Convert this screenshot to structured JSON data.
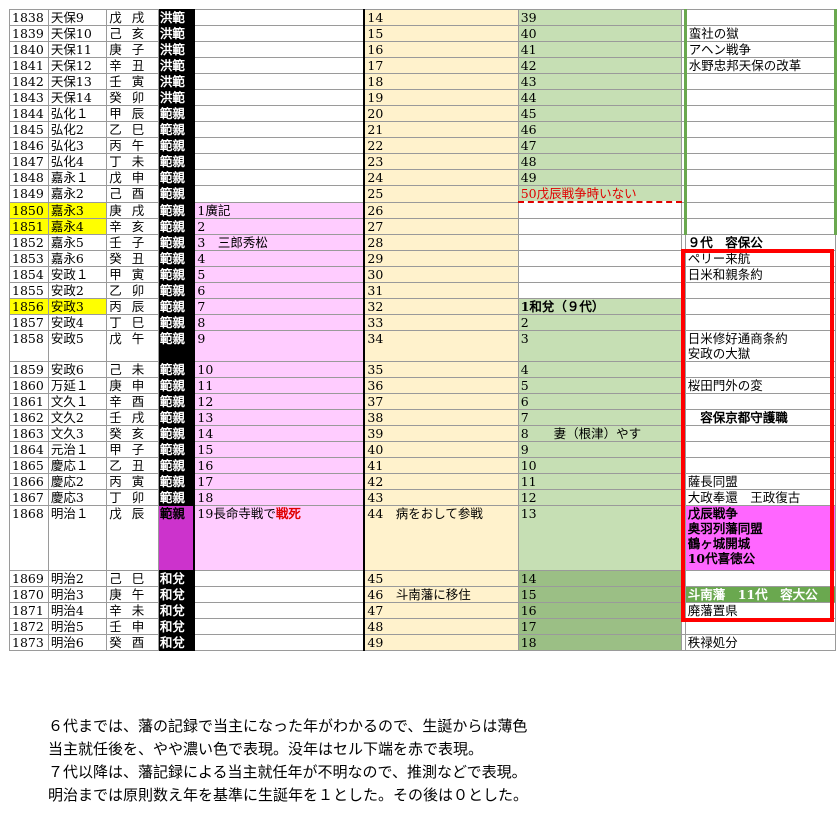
{
  "rows": [
    {
      "year": "1838",
      "era": "天保9",
      "eto": "戊 戌",
      "lord": "洪範",
      "c1": "",
      "c2": "14",
      "c3": "39",
      "c4": ""
    },
    {
      "year": "1839",
      "era": "天保10",
      "eto": "己 亥",
      "lord": "洪範",
      "c1": "",
      "c2": "15",
      "c3": "40",
      "c4": "蛮社の獄"
    },
    {
      "year": "1840",
      "era": "天保11",
      "eto": "庚 子",
      "lord": "洪範",
      "c1": "",
      "c2": "16",
      "c3": "41",
      "c4": "アヘン戦争"
    },
    {
      "year": "1841",
      "era": "天保12",
      "eto": "辛 丑",
      "lord": "洪範",
      "c1": "",
      "c2": "17",
      "c3": "42",
      "c4": "水野忠邦天保の改革"
    },
    {
      "year": "1842",
      "era": "天保13",
      "eto": "壬 寅",
      "lord": "洪範",
      "c1": "",
      "c2": "18",
      "c3": "43",
      "c4": ""
    },
    {
      "year": "1843",
      "era": "天保14",
      "eto": "癸 卯",
      "lord": "洪範",
      "c1": "",
      "c2": "19",
      "c3": "44",
      "c4": ""
    },
    {
      "year": "1844",
      "era": "弘化１",
      "eto": "甲 辰",
      "lord": "範親",
      "c1": "",
      "c2": "20",
      "c3": "45",
      "c4": ""
    },
    {
      "year": "1845",
      "era": "弘化2",
      "eto": "乙 巳",
      "lord": "範親",
      "c1": "",
      "c2": "21",
      "c3": "46",
      "c4": ""
    },
    {
      "year": "1846",
      "era": "弘化3",
      "eto": "丙 午",
      "lord": "範親",
      "c1": "",
      "c2": "22",
      "c3": "47",
      "c4": ""
    },
    {
      "year": "1847",
      "era": "弘化4",
      "eto": "丁 未",
      "lord": "範親",
      "c1": "",
      "c2": "23",
      "c3": "48",
      "c4": ""
    },
    {
      "year": "1848",
      "era": "嘉永１",
      "eto": "戊 申",
      "lord": "範親",
      "c1": "",
      "c2": "24",
      "c3": "49",
      "c4": ""
    },
    {
      "year": "1849",
      "era": "嘉永2",
      "eto": "己 酉",
      "lord": "範親",
      "c1": "",
      "c2": "25",
      "c3": "50戊辰戦争時いない",
      "c4": ""
    },
    {
      "year": "1850",
      "era": "嘉永3",
      "eto": "庚 戌",
      "lord": "範親",
      "c1": "1廣記",
      "c2": "26",
      "c3": "",
      "c4": ""
    },
    {
      "year": "1851",
      "era": "嘉永4",
      "eto": "辛 亥",
      "lord": "範親",
      "c1": "2",
      "c2": "27",
      "c3": "",
      "c4": ""
    },
    {
      "year": "1852",
      "era": "嘉永5",
      "eto": "壬 子",
      "lord": "範親",
      "c1": "3　三郎秀松",
      "c2": "28",
      "c3": "",
      "c4": "９代　容保公"
    },
    {
      "year": "1853",
      "era": "嘉永6",
      "eto": "癸 丑",
      "lord": "範親",
      "c1": "4",
      "c2": "29",
      "c3": "",
      "c4": "ペリー来航"
    },
    {
      "year": "1854",
      "era": "安政１",
      "eto": "甲 寅",
      "lord": "範親",
      "c1": "5",
      "c2": "30",
      "c3": "",
      "c4": "日米和親条約"
    },
    {
      "year": "1855",
      "era": "安政2",
      "eto": "乙 卯",
      "lord": "範親",
      "c1": "6",
      "c2": "31",
      "c3": "",
      "c4": ""
    },
    {
      "year": "1856",
      "era": "安政3",
      "eto": "丙 辰",
      "lord": "範親",
      "c1": "7",
      "c2": "32",
      "c3": "1和兌（９代）",
      "c4": ""
    },
    {
      "year": "1857",
      "era": "安政4",
      "eto": "丁 巳",
      "lord": "範親",
      "c1": "8",
      "c2": "33",
      "c3": "2",
      "c4": ""
    },
    {
      "year": "1858",
      "era": "安政5",
      "eto": "戊 午",
      "lord": "範親",
      "c1": "9",
      "c2": "34",
      "c3": "3",
      "c4": "日米修好通商条約\n安政の大獄"
    },
    {
      "year": "1859",
      "era": "安政6",
      "eto": "己 未",
      "lord": "範親",
      "c1": "10",
      "c2": "35",
      "c3": "4",
      "c4": ""
    },
    {
      "year": "1860",
      "era": "万延１",
      "eto": "庚 申",
      "lord": "範親",
      "c1": "11",
      "c2": "36",
      "c3": "5",
      "c4": "桜田門外の変"
    },
    {
      "year": "1861",
      "era": "文久１",
      "eto": "辛 酉",
      "lord": "範親",
      "c1": "12",
      "c2": "37",
      "c3": "6",
      "c4": ""
    },
    {
      "year": "1862",
      "era": "文久2",
      "eto": "壬 戌",
      "lord": "範親",
      "c1": "13",
      "c2": "38",
      "c3": "7",
      "c4": "　容保京都守護職"
    },
    {
      "year": "1863",
      "era": "文久3",
      "eto": "癸 亥",
      "lord": "範親",
      "c1": "14",
      "c2": "39",
      "c3": "8　　妻（根津）やす",
      "c4": ""
    },
    {
      "year": "1864",
      "era": "元治１",
      "eto": "甲 子",
      "lord": "範親",
      "c1": "15",
      "c2": "40",
      "c3": "9",
      "c4": ""
    },
    {
      "year": "1865",
      "era": "慶応１",
      "eto": "乙 丑",
      "lord": "範親",
      "c1": "16",
      "c2": "41",
      "c3": "10",
      "c4": ""
    },
    {
      "year": "1866",
      "era": "慶応2",
      "eto": "丙 寅",
      "lord": "範親",
      "c1": "17",
      "c2": "42",
      "c3": "11",
      "c4": "薩長同盟"
    },
    {
      "year": "1867",
      "era": "慶応3",
      "eto": "丁 卯",
      "lord": "範親",
      "c1": "18",
      "c2": "43",
      "c3": "12",
      "c4": "大政奉還　王政復古"
    },
    {
      "year": "1868",
      "era": "明治１",
      "eto": "戊 辰",
      "lord": "範親",
      "c1": "19長命寺戦で",
      "c1_red": "戦死",
      "c2": "44　病をおして参戦",
      "c3": "13",
      "c4": "戊辰戦争\n奥羽列藩同盟\n鶴ヶ城開城\n10代喜徳公"
    },
    {
      "year": "1869",
      "era": "明治2",
      "eto": "己 巳",
      "lord": "和兌",
      "c1": "",
      "c2": "45",
      "c3": "14",
      "c4": ""
    },
    {
      "year": "1870",
      "era": "明治3",
      "eto": "庚 午",
      "lord": "和兌",
      "c1": "",
      "c2": "46　斗南藩に移住",
      "c3": "15",
      "c4": "斗南藩　11代　容大公"
    },
    {
      "year": "1871",
      "era": "明治4",
      "eto": "辛 未",
      "lord": "和兌",
      "c1": "",
      "c2": "47",
      "c3": "16",
      "c4": "廃藩置県"
    },
    {
      "year": "1872",
      "era": "明治5",
      "eto": "壬 申",
      "lord": "和兌",
      "c1": "",
      "c2": "48",
      "c3": "17",
      "c4": ""
    },
    {
      "year": "1873",
      "era": "明治6",
      "eto": "癸 酉",
      "lord": "和兌",
      "c1": "",
      "c2": "49",
      "c3": "18",
      "c4": "秩禄処分"
    }
  ],
  "notes": [
    "６代までは、藩の記録で当主になった年がわかるので、生誕からは薄色",
    "当主就任後を、やや濃い色で表現。没年はセル下端を赤で表現。",
    "７代以降は、藩記録による当主就任年が不明なので、推測などで表現。",
    "明治までは原則数え年を基準に生誕年を１とした。その後は０とした。"
  ]
}
